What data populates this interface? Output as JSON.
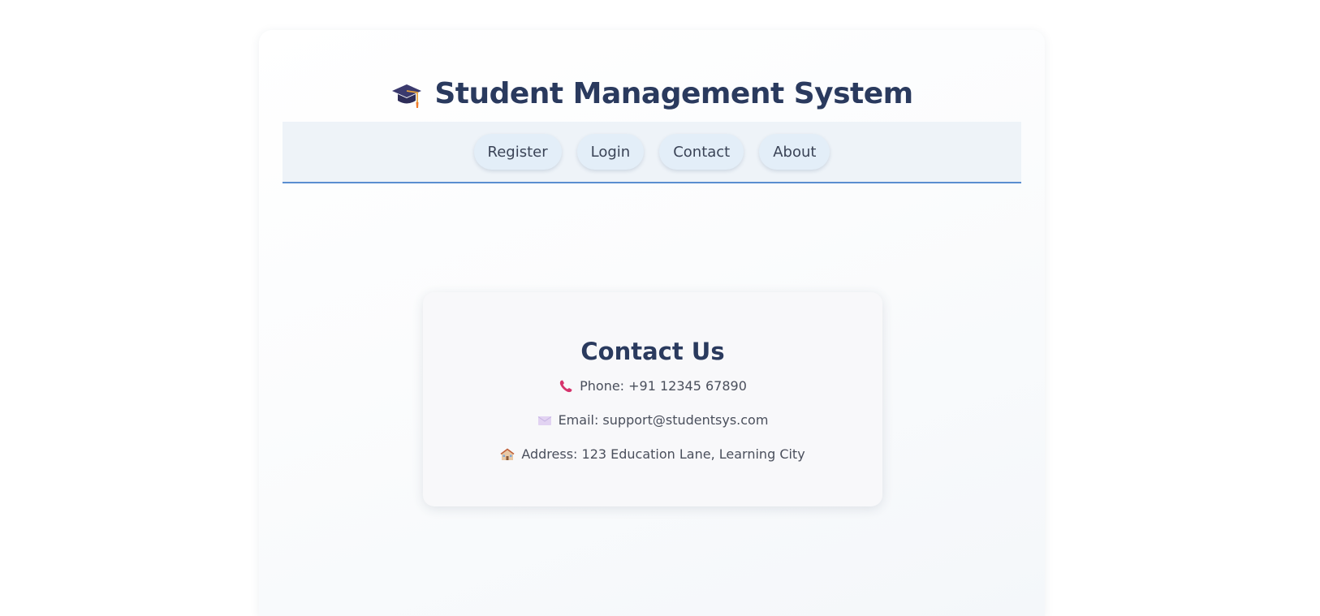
{
  "header": {
    "title": "Student Management System",
    "icon": "graduation-cap-icon"
  },
  "nav": {
    "items": [
      {
        "label": "Register"
      },
      {
        "label": "Login"
      },
      {
        "label": "Contact"
      },
      {
        "label": "About"
      }
    ]
  },
  "contact": {
    "heading": "Contact Us",
    "phone": {
      "text": "Phone: +91 12345 67890",
      "icon": "telephone-icon"
    },
    "email": {
      "text": "Email: support@studentsys.com",
      "icon": "envelope-icon"
    },
    "address": {
      "text": "Address: 123 Education Lane, Learning City",
      "icon": "school-building-icon"
    }
  },
  "colors": {
    "title": "#2a3a5e",
    "nav_background": "#eef3f8",
    "nav_border": "#5a8ed0",
    "button_background": "#e3eef8",
    "card_background": "#f8f8fa"
  }
}
